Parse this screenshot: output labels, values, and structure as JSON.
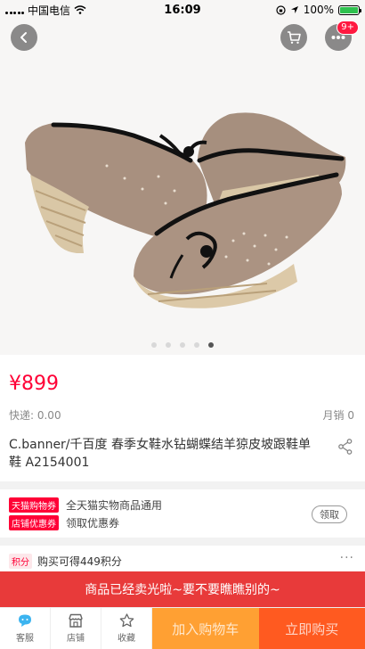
{
  "status_bar": {
    "carrier": "中国电信",
    "time": "16:09",
    "battery": "100%",
    "battery_level": 1.0
  },
  "header": {
    "back_icon": "chevron-left-icon",
    "cart_icon": "cart-icon",
    "more_icon": "more-dots-icon",
    "more_badge": "9+"
  },
  "gallery": {
    "page_count": 5,
    "active_index": 4
  },
  "product": {
    "price": "¥899",
    "shipping": "快递: 0.00",
    "monthly_sales": "月销 0",
    "title": "C.banner/千百度 春季女鞋水钻蝴蝶结羊猄皮坡跟鞋单鞋 A2154001"
  },
  "promotions": {
    "row1_tag": "天猫购物券",
    "row1_text": "全天猫实物商品通用",
    "row2_tag": "店铺优惠券",
    "row2_text": "领取优惠券",
    "claim_label": "领取"
  },
  "points": {
    "tag": "积分",
    "text": "购买可得449积分",
    "more": "···"
  },
  "notice": "商品已经卖光啦~要不要瞧瞧别的~",
  "bottom_bar": {
    "service": "客服",
    "shop": "店铺",
    "favorite": "收藏",
    "add_to_cart": "加入购物车",
    "buy_now": "立即购买"
  },
  "colors": {
    "price": "#ff0036",
    "notice_bg": "#e83a3a",
    "add_cart_bg": "#ffa033",
    "buy_now_bg": "#ff5a20"
  }
}
